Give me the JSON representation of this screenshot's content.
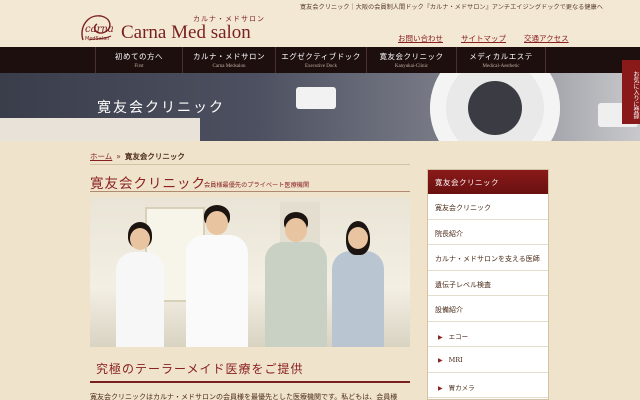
{
  "header": {
    "tagline": "寛友会クリニック｜大阪の会員制人間ドック『カルナ・メドサロン』アンチエイジングドックで更なる健康へ",
    "logo": {
      "mark_script": "carna",
      "mark_sub": "MedSalon",
      "kana": "カルナ・メドサロン",
      "name": "Carna Med salon"
    },
    "util_links": [
      "お問い合わせ",
      "サイトマップ",
      "交通アクセス"
    ]
  },
  "nav": {
    "items": [
      {
        "jp": "初めての方へ",
        "en": "First"
      },
      {
        "jp": "カルナ・メドサロン",
        "en": "Carna Medsalon"
      },
      {
        "jp": "エグゼクティブドック",
        "en": "Executive Dock"
      },
      {
        "jp": "寛友会クリニック",
        "en": "Kanyukai-Clinic"
      },
      {
        "jp": "メディカルエステ",
        "en": "Medical-Aesthetic"
      }
    ]
  },
  "hero": {
    "title": "寛友会クリニック",
    "fav_tab": "お気に入りに登録"
  },
  "breadcrumb": {
    "home": "ホーム",
    "sep": "»",
    "current": "寛友会クリニック"
  },
  "main": {
    "title": "寛友会クリニック",
    "subtitle": "会員様最優先のプライベート医療機関",
    "section_title": "究極のテーラーメイド医療をご提供",
    "body": "寛友会クリニックはカルナ・メドサロンの会員様を最優先とした医療機関です。私どもは、会員様"
  },
  "sidebar": {
    "heading": "寛友会クリニック",
    "items": [
      {
        "label": "寛友会クリニック",
        "sub": false
      },
      {
        "label": "院長紹介",
        "sub": false
      },
      {
        "label": "カルナ・メドサロンを支える医師",
        "sub": false
      },
      {
        "label": "遺伝子レベル検査",
        "sub": false
      },
      {
        "label": "設備紹介",
        "sub": false
      },
      {
        "label": "エコー",
        "sub": true
      },
      {
        "label": "MRI",
        "sub": true
      },
      {
        "label": "胃カメラ",
        "sub": true
      }
    ]
  },
  "colors": {
    "brand": "#7a1f1f",
    "nav_bg": "#1e0f0f",
    "page_bg": "#efe3cc"
  }
}
